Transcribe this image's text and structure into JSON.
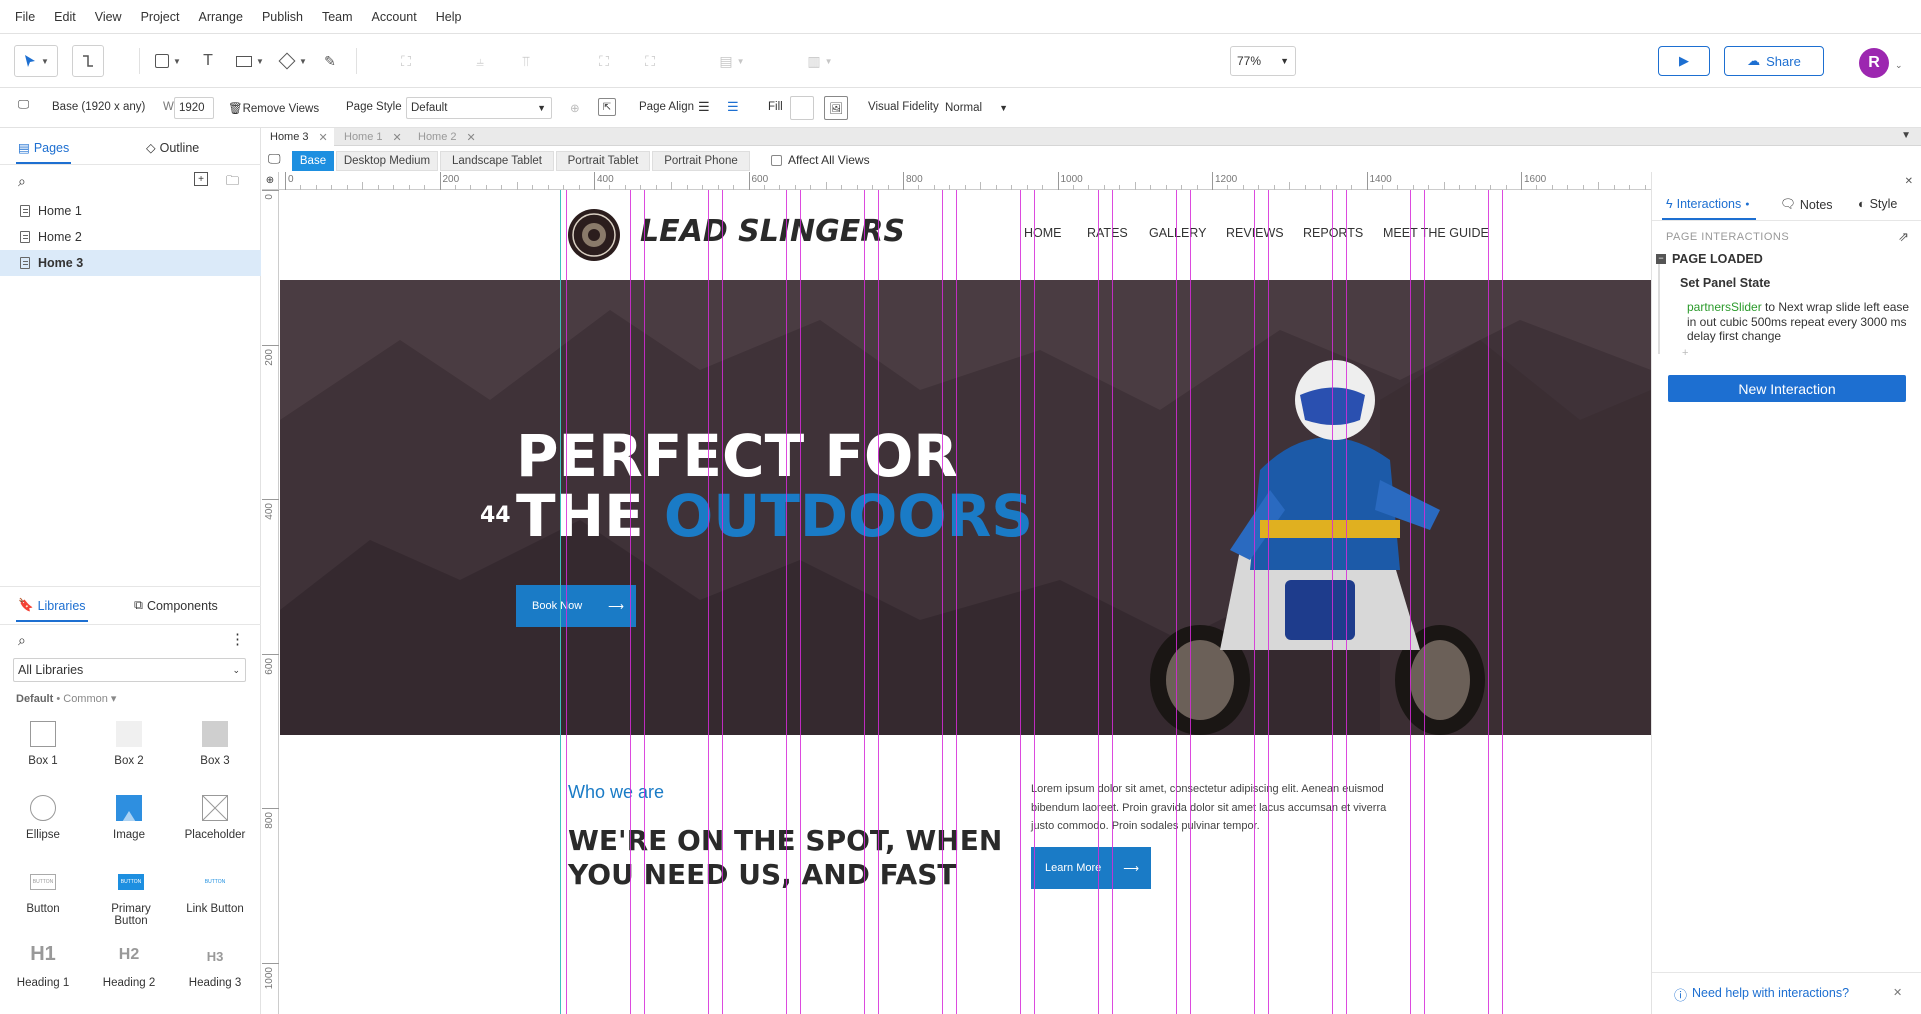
{
  "menu": [
    "File",
    "Edit",
    "View",
    "Project",
    "Arrange",
    "Publish",
    "Team",
    "Account",
    "Help"
  ],
  "toolbar": {
    "zoom": "77%",
    "share_label": "Share",
    "avatar_initial": "R"
  },
  "props": {
    "view_label": "Base (1920 x any)",
    "width_label": "W",
    "width_value": "1920",
    "remove_views": "Remove Views",
    "page_style_label": "Page Style",
    "page_style_value": "Default",
    "page_align_label": "Page Align",
    "fill_label": "Fill",
    "visual_fidelity_label": "Visual Fidelity",
    "visual_fidelity_value": "Normal"
  },
  "left": {
    "tabs": {
      "pages": "Pages",
      "outline": "Outline"
    },
    "pages": [
      "Home 1",
      "Home 2",
      "Home 3"
    ],
    "selected_page": "Home 3",
    "lib_tabs": {
      "libraries": "Libraries",
      "components": "Components"
    },
    "library_select": "All Libraries",
    "library_group": "Default",
    "library_sub": "Common",
    "widgets": [
      "Box 1",
      "Box 2",
      "Box 3",
      "Ellipse",
      "Image",
      "Placeholder",
      "Button",
      "Primary Button",
      "Link Button",
      "Heading 1",
      "Heading 2",
      "Heading 3"
    ],
    "widget_glyphs": {
      "primary": "BUTTON",
      "link": "BUTTON",
      "button": "BUTTON",
      "h1": "H1",
      "h2": "H2",
      "h3": "H3"
    }
  },
  "canvas": {
    "file_tabs": [
      "Home 3",
      "Home 1",
      "Home 2"
    ],
    "views": [
      "Base",
      "Desktop Medium",
      "Landscape Tablet",
      "Portrait Tablet",
      "Portrait Phone"
    ],
    "affect_all": "Affect All Views",
    "ruler_h": [
      "0",
      "200",
      "400",
      "600",
      "800",
      "1000",
      "1200",
      "1400",
      "1600"
    ],
    "ruler_v": [
      "0",
      "200",
      "400",
      "600",
      "800",
      "1000"
    ]
  },
  "site": {
    "brand": "LEAD SLINGERS",
    "nav": [
      "HOME",
      "RATES",
      "GALLERY",
      "REVIEWS",
      "REPORTS",
      "MEET THE GUIDE"
    ],
    "hero_line1": "PERFECT FOR",
    "hero_line2a": "THE ",
    "hero_line2b": "OUTDOORS",
    "book_now": "Book Now",
    "who": "Who we are",
    "headline1": "WE'RE ON THE SPOT, WHEN",
    "headline2": "YOU NEED US, AND FAST",
    "lorem": "Lorem ipsum dolor sit amet, consectetur adipiscing elit. Aenean euismod bibendum laoreet. Proin gravida dolor sit amet lacus accumsan et viverra justo commodo. Proin sodales pulvinar tempor.",
    "learn_more": "Learn More",
    "number_plate": "44"
  },
  "right": {
    "tabs": {
      "interactions": "Interactions",
      "notes": "Notes",
      "style": "Style"
    },
    "section": "PAGE INTERACTIONS",
    "event": "PAGE LOADED",
    "action": "Set Panel State",
    "target": "partnersSlider",
    "detail": " to Next wrap slide left ease in out cubic 500ms repeat every 3000 ms delay first change",
    "new_interaction": "New Interaction",
    "help": "Need help with interactions?"
  },
  "colors": {
    "accent": "#1d6fd1",
    "guide": "#d62ad8",
    "site_blue": "#1a7bc6",
    "hero_bg": "#4a3c42"
  }
}
